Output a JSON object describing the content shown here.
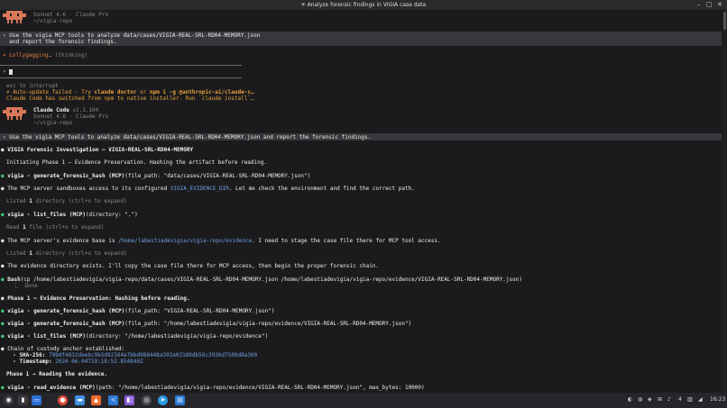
{
  "window": {
    "title": "✳ Analyze forensic findings in VIGIA case data"
  },
  "header1": {
    "model": "Sonnet 4.6 · Claude Pro",
    "cwd": "~/vigia-repo"
  },
  "prompt1": {
    "line1": "› Use the vigia MCP tools to analyze data/cases/VIGIA-REAL-SRL-RD04-MEMORY.json",
    "line2": "  and report the forensic findings."
  },
  "thinking": {
    "label": "Lollygagging…",
    "suffix": " (thinking)"
  },
  "input": {
    "caret": "›"
  },
  "hints": {
    "esc": "esc to interrupt",
    "autoupdate_a": "✗ Auto-update failed · Try ",
    "cmd1": "claude doctor",
    "or": " or ",
    "cmd2": "npm i -g @anthropic-ai/claude-c…",
    "switched": "Claude Code has switched from npm to native installer. Run `claude install`…"
  },
  "header2": {
    "name": "Claude Code",
    "version": "v2.1.104",
    "model": "Sonnet 4.6 · Claude Pro",
    "cwd": "~/vigia-repo"
  },
  "prompt2": "› Use the vigia MCP tools to analyze data/cases/VIGIA-REAL-SRL-RD04-MEMORY.json and report the forensic findings.",
  "log": {
    "heading": "VIGIA Forensic Investigation — VIGIA-REAL-SRL-RD04-MEMORY",
    "phase_intro": "Initiating Phase 1 — Evidence Preservation. Hashing the artifact before reading.",
    "t1_name": "vigia - generate_forensic_hash (MCP)",
    "t1_args": "(file_path: \"data/cases/VIGIA-REAL-SRL-RD04-MEMORY.json\")",
    "sandbox_a": "The MCP server sandboxes access to its configured ",
    "sandbox_code": "VIGIA_EVIDENCE_DIR",
    "sandbox_b": ". Let me check the environment and find the correct path.",
    "listed1_a": "Listed ",
    "listed1_n": "1",
    "listed1_b": " directory (ctrl+o to expand)",
    "t2_name": "vigia - list_files (MCP)",
    "t2_args": "(directory: \".\")",
    "read1_a": "Read ",
    "read1_n": "1",
    "read1_b": " file (ctrl+o to expand)",
    "base_a": "The MCP server's evidence base is ",
    "base_path": "/home/labestiadevigia/vigia-repo/evidence",
    "base_b": ". I need to stage the case file there for MCP tool access.",
    "listed2_a": "Listed ",
    "listed2_n": "1",
    "listed2_b": " directory (ctrl+o to expand)",
    "exists": "The evidence directory exists. I'll copy the case file there for MCP access, then begin the proper forensic chain.",
    "bash_name": "Bash",
    "bash_args": "(cp /home/labestiadevigia/vigia-repo/data/cases/VIGIA-REAL-SRL-RD04-MEMORY.json /home/labestiadevigia/vigia-repo/evidence/VIGIA-REAL-SRL-RD04-MEMORY.json)",
    "done": "  ⎿  Done",
    "phase1": "Phase 1 — Evidence Preservation: Hashing before reading.",
    "t3_name": "vigia - generate_forensic_hash (MCP)",
    "t3_args": "(file_path: \"VIGIA-REAL-SRL-RD04-MEMORY.json\")",
    "t4_name": "vigia - generate_forensic_hash (MCP)",
    "t4_args": "(file_path: \"/home/labestiadevigia/vigia-repo/evidence/VIGIA-REAL-SRL-RD04-MEMORY.json\")",
    "t5_name": "vigia - list_files (MCP)",
    "t5_args": "(directory: \"/home/labestiadevigia/vigia-repo/evidence\")",
    "chain": "Chain of custody anchor established:",
    "sha_label": "  - SHA-256:",
    "sha_value": " 79bdf4832deebc9b5d92164a7bbd088448a393a02189db56c3926d7500d8a300",
    "ts_label": "  - Timestamp:",
    "ts_value": " 2026-06-04T19:18:52.854840Z",
    "phase1b": "Phase 1 → Reading the evidence.",
    "t6_name": "vigia - read_evidence (MCP)",
    "t6_args": "(path: \"/home/labestiadevigia/vigia-repo/evidence/VIGIA-REAL-SRL-RD04-MEMORY.json\", max_bytes: 10000)"
  },
  "taskbar": {
    "apps": [
      "launcher-icon",
      "terminal-icon",
      "chrome-icon",
      "files-icon",
      "brave-icon",
      "vscode-icon",
      "editor-icon",
      "apps-icon",
      "settings-icon",
      "telegram-icon",
      "notes-icon"
    ],
    "tray_count": "4",
    "clock": "16:23"
  },
  "colors": {
    "accent": "#e6834a",
    "bullet": "#40c977",
    "link": "#6d9fe0",
    "warning": "#e8a23a"
  }
}
